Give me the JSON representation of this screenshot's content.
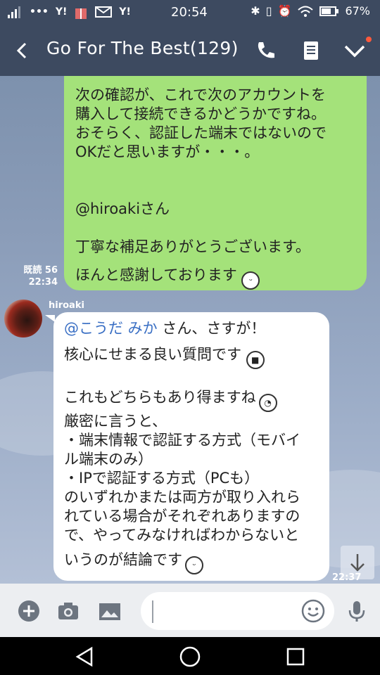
{
  "status": {
    "time": "20:54",
    "battery": "67%",
    "carrier_icons": [
      "signal-icon",
      "dots-icon",
      "yahoo-icon",
      "gift-icon",
      "mail-icon",
      "yahoo-icon"
    ]
  },
  "header": {
    "title": "Go For The Best(129)"
  },
  "messages": {
    "mine": {
      "lines": [
        "次の確認が、これで次のアカウントを",
        "購入して接続できるかどうかですね。",
        "おそらく、認証した端末ではないので",
        "OKだと思いますが・・・。",
        "",
        "",
        "@hiroakiさん",
        "",
        "丁寧な補足ありがとうございます。"
      ],
      "last_line": "ほんと感謝しております",
      "read_label": "既読 56",
      "time": "22:34"
    },
    "theirs": {
      "sender": "hiroaki",
      "mention": "@こうだ みか",
      "line1_rest": " さん、さすが！",
      "line2": "核心にせまる良い質問です",
      "lines": [
        "これもどちらもあり得ますね",
        "厳密に言うと、",
        "・端末情報で認証する方式（モバイ",
        "ル端末のみ）",
        "・IPで認証する方式（PCも）",
        "のいずれかまたは両方が取り入れら",
        "れている場合がそれぞれありますの",
        "で、やってみなければわからないと",
        "いうのが結論です"
      ],
      "time": "22:37"
    }
  },
  "colors": {
    "header_bg": "#3d4a60",
    "my_bubble": "#a4e27a",
    "their_bubble": "#ffffff",
    "mention": "#3a6fc4"
  }
}
